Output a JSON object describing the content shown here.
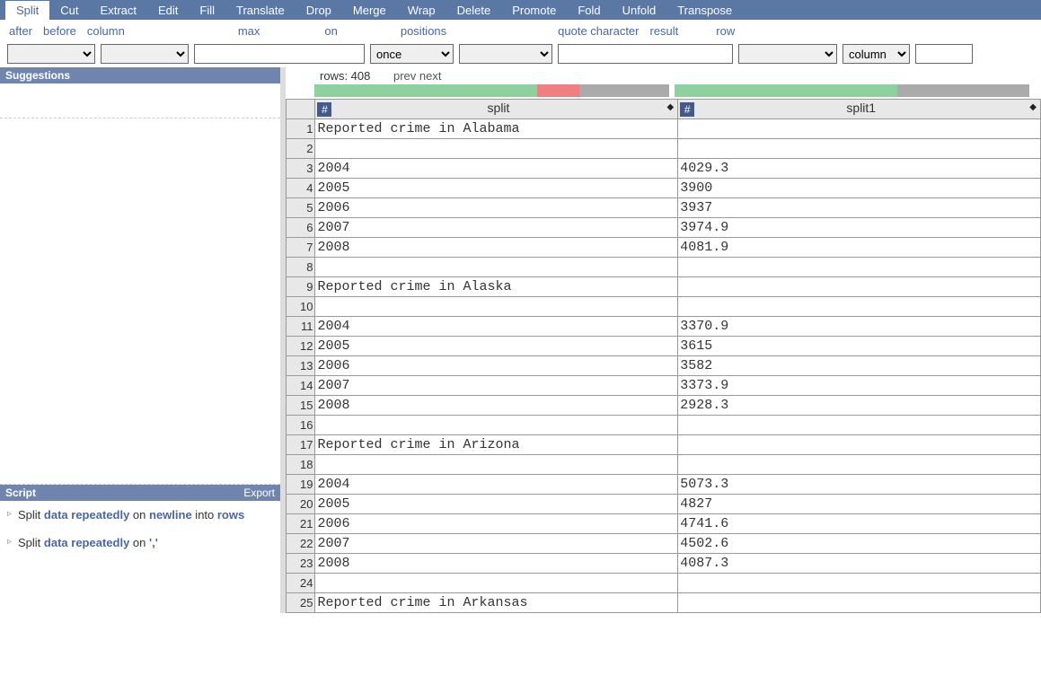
{
  "menu": [
    "Split",
    "Cut",
    "Extract",
    "Edit",
    "Fill",
    "Translate",
    "Drop",
    "Merge",
    "Wrap",
    "Delete",
    "Promote",
    "Fold",
    "Unfold",
    "Transpose"
  ],
  "menu_active": 0,
  "params": {
    "after": {
      "label": "after",
      "value": ""
    },
    "before": {
      "label": "before",
      "value": ""
    },
    "column": {
      "label": "column",
      "value": ""
    },
    "max": {
      "label": "max",
      "value": "once"
    },
    "on": {
      "label": "on",
      "value": ""
    },
    "positions": {
      "label": "positions",
      "value": ""
    },
    "quote": {
      "label": "quote character",
      "value": ""
    },
    "result": {
      "label": "result",
      "value": "column"
    },
    "row": {
      "label": "row",
      "value": ""
    }
  },
  "suggestions_title": "Suggestions",
  "script_title": "Script",
  "export_label": "Export",
  "script": [
    {
      "parts": [
        "Split ",
        "data",
        " ",
        "repeatedly",
        " on ",
        "newline",
        " into ",
        "rows"
      ]
    },
    {
      "parts": [
        "Split ",
        "data",
        " ",
        "repeatedly",
        " on ",
        "','"
      ]
    }
  ],
  "table": {
    "rows_label": "rows: 408",
    "prev": "prev",
    "next": "next",
    "columns": [
      "split",
      "split1"
    ],
    "qualbar": [
      {
        "green": 248,
        "red": 47,
        "gray": 100
      },
      {
        "green": 248,
        "gray": 147
      }
    ],
    "data": [
      {
        "n": 1,
        "c0": "Reported crime in Alabama",
        "c1": ""
      },
      {
        "n": 2,
        "c0": "",
        "c1": ""
      },
      {
        "n": 3,
        "c0": "2004",
        "c1": "4029.3"
      },
      {
        "n": 4,
        "c0": "2005",
        "c1": "3900"
      },
      {
        "n": 5,
        "c0": "2006",
        "c1": "3937"
      },
      {
        "n": 6,
        "c0": "2007",
        "c1": "3974.9"
      },
      {
        "n": 7,
        "c0": "2008",
        "c1": "4081.9"
      },
      {
        "n": 8,
        "c0": "",
        "c1": ""
      },
      {
        "n": 9,
        "c0": "Reported crime in Alaska",
        "c1": ""
      },
      {
        "n": 10,
        "c0": "",
        "c1": ""
      },
      {
        "n": 11,
        "c0": "2004",
        "c1": "3370.9"
      },
      {
        "n": 12,
        "c0": "2005",
        "c1": "3615"
      },
      {
        "n": 13,
        "c0": "2006",
        "c1": "3582"
      },
      {
        "n": 14,
        "c0": "2007",
        "c1": "3373.9"
      },
      {
        "n": 15,
        "c0": "2008",
        "c1": "2928.3"
      },
      {
        "n": 16,
        "c0": "",
        "c1": ""
      },
      {
        "n": 17,
        "c0": "Reported crime in Arizona",
        "c1": ""
      },
      {
        "n": 18,
        "c0": "",
        "c1": ""
      },
      {
        "n": 19,
        "c0": "2004",
        "c1": "5073.3"
      },
      {
        "n": 20,
        "c0": "2005",
        "c1": "4827"
      },
      {
        "n": 21,
        "c0": "2006",
        "c1": "4741.6"
      },
      {
        "n": 22,
        "c0": "2007",
        "c1": "4502.6"
      },
      {
        "n": 23,
        "c0": "2008",
        "c1": "4087.3"
      },
      {
        "n": 24,
        "c0": "",
        "c1": ""
      },
      {
        "n": 25,
        "c0": "Reported crime in Arkansas",
        "c1": ""
      }
    ]
  }
}
